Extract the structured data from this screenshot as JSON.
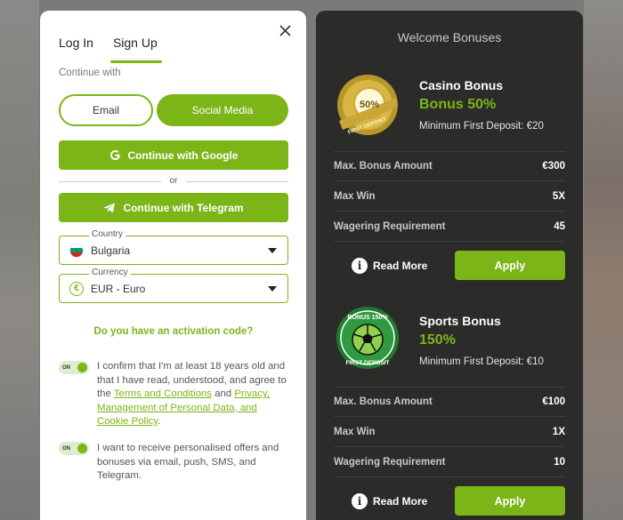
{
  "auth": {
    "tabs": [
      "Log In",
      "Sign Up"
    ],
    "continue_with": "Continue with",
    "method_email": "Email",
    "method_social": "Social Media",
    "google_btn": "Continue with Google",
    "or": "or",
    "telegram_btn": "Continue with Telegram",
    "country_label": "Country",
    "country_value": "Bulgaria",
    "currency_label": "Currency",
    "currency_value": "EUR - Euro",
    "activation": "Do you have an activation code?",
    "toggle_on": "ON",
    "consent1_pre": "I confirm that I'm at least 18 years old and that I have read, understood, and agree to the ",
    "consent1_link1": "Terms and Conditions",
    "consent1_mid": " and ",
    "consent1_link2": "Privacy, Management of Personal Data, and Cookie Policy",
    "consent1_end": ".",
    "consent2": "I want to receive personalised offers and bonuses via email, push, SMS, and Telegram."
  },
  "bonuses": {
    "title": "Welcome Bonuses",
    "casino": {
      "badge_pct": "50%",
      "badge_text": "FIRST DEPOSIT",
      "name": "Casino Bonus",
      "pct": "Bonus 50%",
      "min_deposit": "Minimum First Deposit: €20",
      "rows": [
        {
          "k": "Max. Bonus Amount",
          "v": "€300"
        },
        {
          "k": "Max Win",
          "v": "5X"
        },
        {
          "k": "Wagering Requirement",
          "v": "45"
        }
      ],
      "read_more": "Read More",
      "apply": "Apply"
    },
    "sports": {
      "badge_top": "BONUS 150%",
      "badge_bottom": "FIRST DEPOSIT",
      "name": "Sports Bonus",
      "pct": "150%",
      "min_deposit": "Minimum First Deposit: €10",
      "rows": [
        {
          "k": "Max. Bonus Amount",
          "v": "€100"
        },
        {
          "k": "Max Win",
          "v": "1X"
        },
        {
          "k": "Wagering Requirement",
          "v": "10"
        }
      ],
      "read_more": "Read More",
      "apply": "Apply"
    }
  },
  "colors": {
    "accent": "#7cb518",
    "panel": "#2b2c29"
  }
}
